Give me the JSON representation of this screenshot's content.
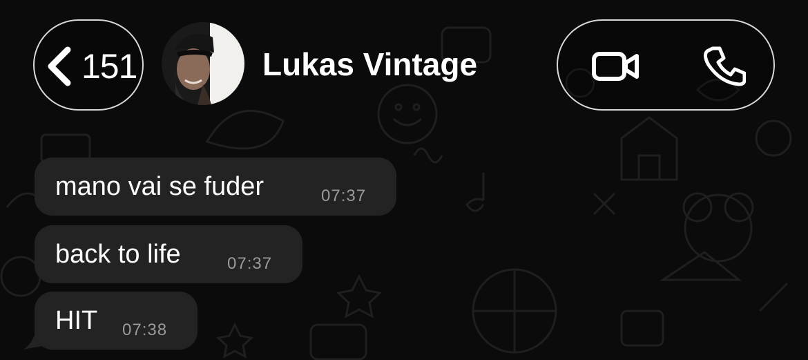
{
  "header": {
    "back_count": "151",
    "contact_name": "Lukas Vintage",
    "back_icon": "chevron-left-icon",
    "video_icon": "video-camera-icon",
    "phone_icon": "phone-icon"
  },
  "messages": [
    {
      "text": "mano vai se fuder",
      "time": "07:37"
    },
    {
      "text": "back to life",
      "time": "07:37"
    },
    {
      "text": "HIT",
      "time": "07:38"
    }
  ],
  "colors": {
    "background": "#0b0b0b",
    "bubble": "#232323",
    "text": "#ffffff",
    "timestamp": "#9a9a9a"
  }
}
